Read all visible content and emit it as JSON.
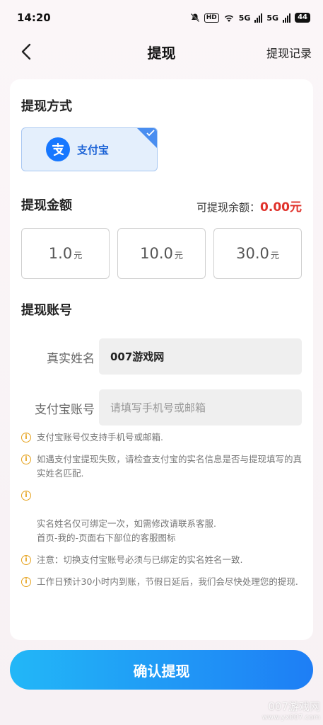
{
  "status_bar": {
    "time": "14:20",
    "battery": "44",
    "network1": "5G",
    "network2": "5G"
  },
  "nav": {
    "title": "提现",
    "right_label": "提现记录"
  },
  "method": {
    "title": "提现方式",
    "option_label": "支付宝",
    "option_icon": "alipay-icon",
    "selected": true
  },
  "amount": {
    "title": "提现金额",
    "balance_label": "可提现余额：",
    "balance_value": "0.00元",
    "options": [
      {
        "value": "1.0",
        "unit": "元"
      },
      {
        "value": "10.0",
        "unit": "元"
      },
      {
        "value": "30.0",
        "unit": "元"
      }
    ]
  },
  "account": {
    "title": "提现账号",
    "name_label": "真实姓名",
    "name_value": "007游戏网",
    "alipay_label": "支付宝账号",
    "alipay_placeholder": "请填写手机号或邮箱"
  },
  "notes": [
    "支付宝账号仅支持手机号或邮箱.",
    "如遇支付宝提现失败，请检查支付宝的实名信息是否与提现填写的真实姓名匹配.",
    "实名姓名仅可绑定一次，如需修改请联系客服.\n首页-我的-页面右下部位的客服图标",
    "注意：切换支付宝账号必须与已绑定的实名姓名一致.",
    "工作日预计30小时内到账，节假日延后，我们会尽快处理您的提现."
  ],
  "confirm_label": "确认提现",
  "watermark": {
    "line1": "007游戏网",
    "line2": "www.yx007.com"
  },
  "colors": {
    "accent": "#1e7ef5",
    "balance": "#e0322b",
    "warning": "#e6a21d"
  }
}
